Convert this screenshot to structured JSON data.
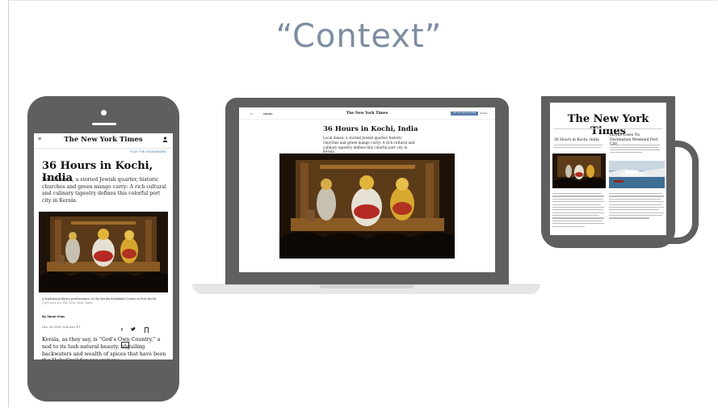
{
  "slide": {
    "title": "“Context”"
  },
  "phone": {
    "logo": "The New York Times",
    "menu_icon": "≡",
    "user_icon": "user-icon",
    "link": "PLAY THE CROSSWORD",
    "headline": "36 Hours in Kochi, India",
    "dek": "Local dance, a storied Jewish quarter, historic churches and green mango curry: A rich cultural and culinary tapestry defines this colorful port city in Kerala.",
    "caption": "A traditional dance performance at the Kerala Kathakali Center in Fort Kochi.",
    "credit": "Joel Leiva for The New York Times",
    "byline": "By Sarah Khan",
    "date": "Dec. 26, 2019, 5:00 a.m. ET",
    "share": {
      "facebook": "f",
      "twitter": "🐦",
      "comment_count": "0"
    },
    "body": "Kerala, as they say, is “God’s Own Country,” a nod to its lush natural beauty, beguiling backwaters and wealth of spices that have been the Holy Grail for generations"
  },
  "laptop": {
    "section": "TRAVEL",
    "logo": "The New York Times",
    "subscribe": "GET 50% OFF FOR A YEAR",
    "account": "Account",
    "headline": "36 Hours in Kochi, India",
    "dek": "Local dance, a storied Jewish quarter, historic churches and green mango curry: A rich cultural and culinary tapestry defines this colorful port city in Kerala."
  },
  "newspaper": {
    "logo": "The New York Times",
    "headline_left": "36 Hours in Kochi, India",
    "headline_right": "Lloyds Loses No Destination Weekend Port City"
  }
}
